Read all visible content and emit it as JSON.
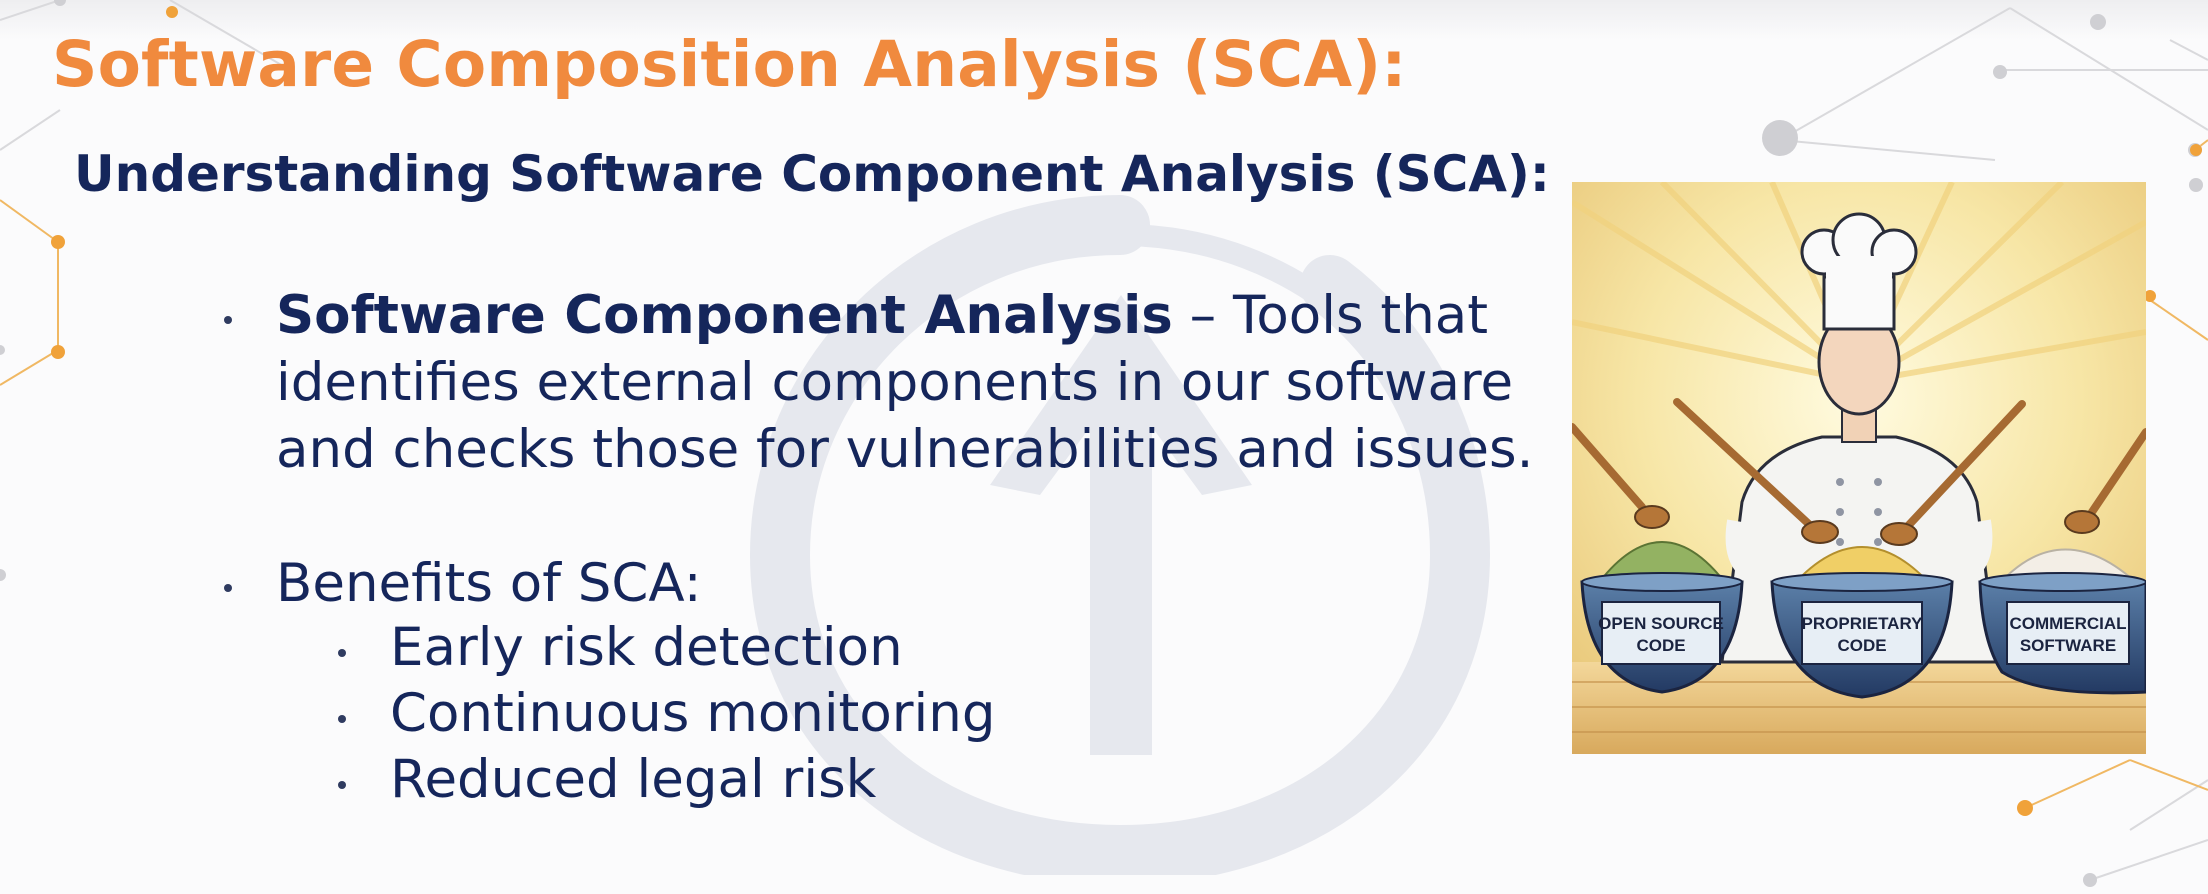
{
  "slide": {
    "title": "Software Composition Analysis (SCA):",
    "subtitle": "Understanding Software Component Analysis (SCA):",
    "bullets": [
      {
        "bold": "Software Component Analysis",
        "rest_line1": " – Tools that",
        "line2": "identifies external components in our software",
        "line3": "and checks those for vulnerabilities and issues."
      },
      {
        "text": "Benefits of SCA:",
        "sub_items": [
          "Early risk detection",
          "Continuous monitoring",
          "Reduced legal risk"
        ]
      }
    ]
  },
  "illustration": {
    "bowl_labels": [
      {
        "line1": "OPEN SOURCE",
        "line2": "CODE"
      },
      {
        "line1": "PROPRIETARY",
        "line2": "CODE"
      },
      {
        "line1": "COMMERCIAL",
        "line2": "SOFTWARE"
      }
    ]
  },
  "colors": {
    "title": "#f08a3e",
    "text": "#15265b",
    "accent_orange": "#f0a23a"
  }
}
